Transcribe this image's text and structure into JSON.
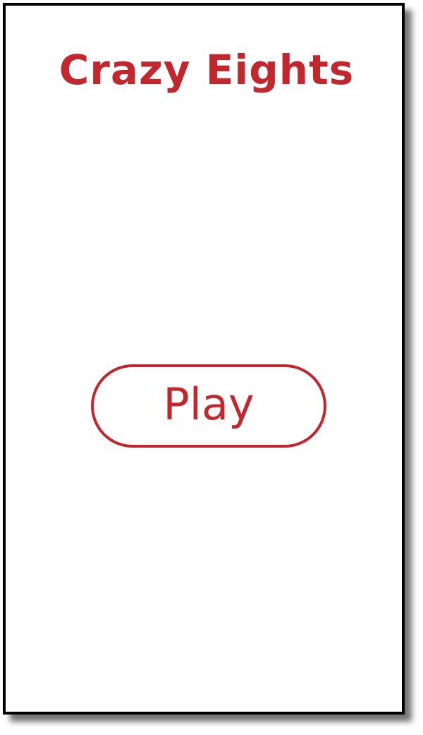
{
  "game": {
    "title": "Crazy Eights",
    "play_label": "Play"
  },
  "colors": {
    "accent": "#c1272d",
    "background": "#ffffff",
    "frame": "#000000"
  }
}
